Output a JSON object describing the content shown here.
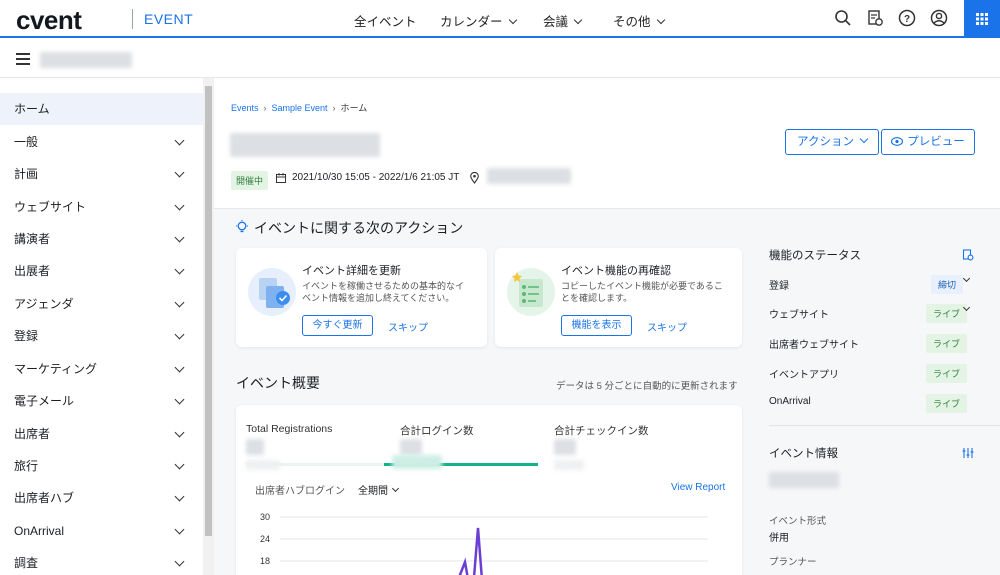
{
  "topbar": {
    "logo": "cvent",
    "logo_sub": "EVENT",
    "nav": [
      "全イベント",
      "カレンダー",
      "会議",
      "その他"
    ]
  },
  "sidebar": {
    "items": [
      "ホーム",
      "一般",
      "計画",
      "ウェブサイト",
      "講演者",
      "出展者",
      "アジェンダ",
      "登録",
      "マーケティング",
      "電子メール",
      "出席者",
      "旅行",
      "出席者ハブ",
      "OnArrival",
      "調査"
    ]
  },
  "breadcrumb": {
    "events": "Events",
    "sample": "Sample Event",
    "current": "ホーム"
  },
  "event": {
    "status": "開催中",
    "dates": "2021/10/30 15:05 - 2022/1/6 21:05 JT",
    "action_button": "アクション",
    "preview_button": "プレビュー"
  },
  "next_actions": {
    "title": "イベントに関する次のアクション",
    "card1": {
      "title": "イベント詳細を更新",
      "desc": "イベントを稼働させるための基本的なイベント情報を追加し終えてください。",
      "primary": "今すぐ更新",
      "skip": "スキップ"
    },
    "card2": {
      "title": "イベント機能の再確認",
      "desc": "コピーしたイベント機能が必要であることを確認します。",
      "primary": "機能を表示",
      "skip": "スキップ"
    }
  },
  "overview": {
    "title": "イベント概要",
    "note": "データは 5 分ごとに自動的に更新されます",
    "stats": [
      "Total Registrations",
      "合計ログイン数",
      "合計チェックイン数"
    ],
    "chart_label": "出席者ハブログイン",
    "period": "全期間",
    "view_report": "View Report"
  },
  "chart_data": {
    "type": "line",
    "yticks": [
      30,
      24,
      18
    ],
    "ylim": [
      0,
      30
    ],
    "color": "#6b3fd4"
  },
  "feature_status": {
    "title": "機能のステータス",
    "items": [
      {
        "label": "登録",
        "status": "締切"
      },
      {
        "label": "ウェブサイト",
        "status": "ライブ"
      },
      {
        "label": "出席者ウェブサイト",
        "status": "ライブ"
      },
      {
        "label": "イベントアプリ",
        "status": "ライブ"
      },
      {
        "label": "OnArrival",
        "status": "ライブ"
      }
    ]
  },
  "event_info": {
    "title": "イベント情報",
    "format_label": "イベント形式",
    "format_value": "併用",
    "planner_label": "プランナー"
  }
}
